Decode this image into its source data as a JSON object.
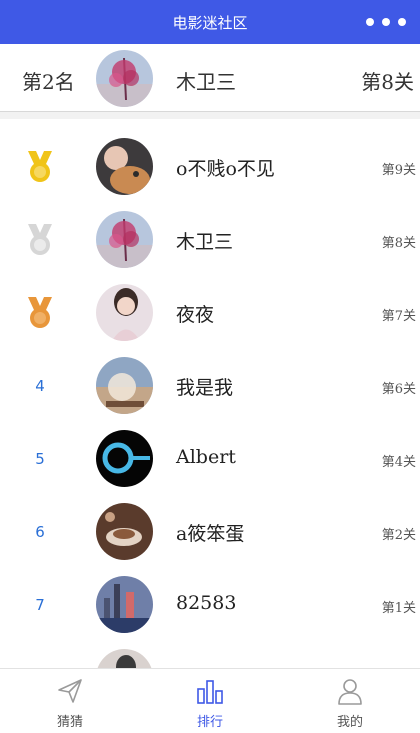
{
  "header": {
    "title": "电影迷社区",
    "more_icon": "more-dots-icon"
  },
  "my_rank": {
    "rank_label": "第2名",
    "name": "木卫三",
    "level": "第8关"
  },
  "leaderboard": [
    {
      "rank": "1",
      "medal": "gold",
      "name": "o不贱o不见",
      "level": "第9关"
    },
    {
      "rank": "2",
      "medal": "silver",
      "name": "木卫三",
      "level": "第8关"
    },
    {
      "rank": "3",
      "medal": "bronze",
      "name": "夜夜",
      "level": "第7关"
    },
    {
      "rank": "4",
      "name": "我是我",
      "level": "第6关"
    },
    {
      "rank": "5",
      "name": "Albert",
      "level": "第4关"
    },
    {
      "rank": "6",
      "name": "a筱笨蛋",
      "level": "第2关"
    },
    {
      "rank": "7",
      "name": "82583",
      "level": "第1关"
    }
  ],
  "tabs": [
    {
      "label": "猜猜",
      "icon": "paper-plane-icon"
    },
    {
      "label": "排行",
      "icon": "bar-chart-icon",
      "active": true
    },
    {
      "label": "我的",
      "icon": "user-icon"
    }
  ],
  "colors": {
    "brand": "#3f59e6",
    "rank_number": "#2a6fd6",
    "gold": "#f0c419",
    "silver": "#d6d6d6",
    "bronze": "#e8963a"
  }
}
